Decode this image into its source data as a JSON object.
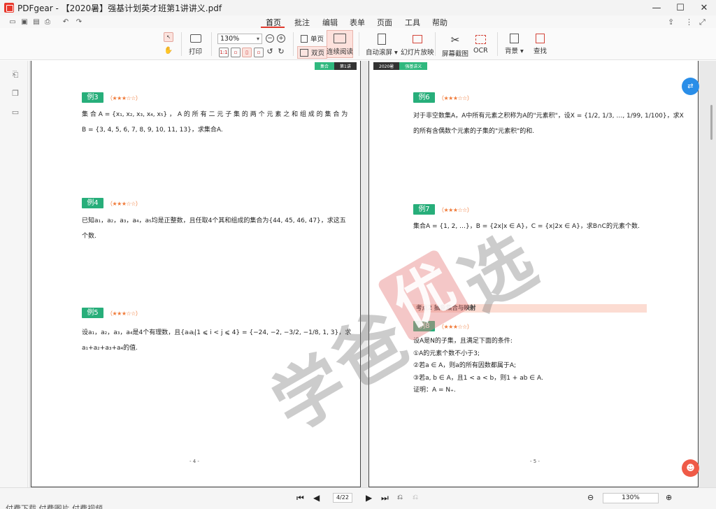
{
  "window": {
    "title": "PDFgear - 【2020暑】强基计划英才班第1讲讲义.pdf",
    "minimize": "—",
    "maximize": "☐",
    "close": "✕"
  },
  "menu": {
    "tabs": [
      "首页",
      "批注",
      "编辑",
      "表单",
      "页面",
      "工具",
      "帮助"
    ],
    "active": "首页"
  },
  "toolbar": {
    "print": "打印",
    "zoom": "130%",
    "single_page": "单页",
    "double_page": "双页",
    "continuous": "连续阅读",
    "auto_scroll": "自动滚屏",
    "slideshow": "幻灯片放映",
    "screenshot": "屏幕截图",
    "ocr": "OCR",
    "background": "背景",
    "find": "查找"
  },
  "pages": {
    "left": {
      "tags": [
        "集合",
        "第1讲"
      ],
      "page_number": "- 4 -",
      "examples": [
        {
          "label": "例3",
          "stars": "（★★★☆☆）",
          "lines": [
            "集 合 A = {x₁, x₂, x₃, x₄, x₅} ， A 的 所 有 二 元 子 集 的 两 个 元 素 之 和 组 成 的 集 合 为",
            "B = {3, 4, 5, 6, 7, 8, 9, 10, 11, 13}，求集合A."
          ]
        },
        {
          "label": "例4",
          "stars": "（★★★☆☆）",
          "lines": [
            "已知a₁，a₂，a₃，a₄，a₅均是正整数，且任取4个其和组成的集合为{44, 45, 46, 47}，求这五",
            "个数."
          ]
        },
        {
          "label": "例5",
          "stars": "（★★★☆☆）",
          "lines": [
            "设a₁，a₂，a₃，a₄是4个有理数，且{aᵢaⱼ|1 ⩽ i < j ⩽ 4} = {−24, −2, −3/2, −1/8, 1, 3}，求",
            "a₁+a₂+a₃+a₄的值."
          ]
        }
      ]
    },
    "right": {
      "tags": [
        "2020暑",
        "强基讲义"
      ],
      "page_number": "- 5 -",
      "section": "考点2  抽象集合与映射",
      "examples": [
        {
          "label": "例6",
          "stars": "（★★★☆☆）",
          "lines": [
            "对于非空数集A，A中所有元素之积称为A的\"元素积\"，设X = {1/2, 1/3, …, 1/99, 1/100}，求X",
            "的所有含偶数个元素的子集的\"元素积\"的和."
          ]
        },
        {
          "label": "例7",
          "stars": "（★★★☆☆）",
          "lines": [
            "集合A = {1, 2, …}，B = {2x|x ∈ A}，C = {x|2x ∈ A}，求B∩C的元素个数."
          ]
        },
        {
          "label": "例8",
          "stars": "（★★★☆☆）",
          "lines": [
            "设A是N的子集，且满足下面的条件:",
            "①A的元素个数不小于3;",
            "②若a ∈ A，则a的所有因数都属于A;",
            "③若a, b ∈ A，且1 < a < b，则1 + ab ∈ A.",
            "证明：A = N₊."
          ]
        }
      ]
    }
  },
  "watermark": {
    "chars": [
      "学",
      "爸",
      "优",
      "选"
    ]
  },
  "status": {
    "page_indicator": "4/22",
    "zoom": "130%"
  },
  "behind_window_text": "付费下载    付费图片    付费视频"
}
